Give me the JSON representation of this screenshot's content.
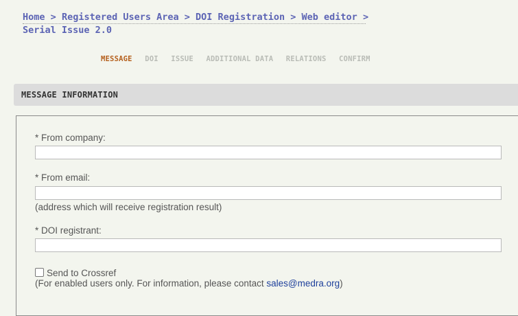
{
  "breadcrumb": {
    "home": "Home",
    "registered_users_area": "Registered Users Area",
    "doi_registration": "DOI Registration",
    "web_editor": "Web editor",
    "separator": ">",
    "current": "Serial Issue 2.0"
  },
  "steps": [
    {
      "label": "MESSAGE",
      "active": true
    },
    {
      "label": "DOI",
      "active": false
    },
    {
      "label": "ISSUE",
      "active": false
    },
    {
      "label": "ADDITIONAL DATA",
      "active": false
    },
    {
      "label": "RELATIONS",
      "active": false
    },
    {
      "label": "CONFIRM",
      "active": false
    }
  ],
  "section": {
    "title": "MESSAGE INFORMATION"
  },
  "form": {
    "from_company": {
      "label": "* From company:",
      "value": ""
    },
    "from_email": {
      "label": "* From email:",
      "value": "",
      "note": "(address which will receive registration result)"
    },
    "doi_registrant": {
      "label": "* DOI registrant:",
      "value": ""
    },
    "crossref": {
      "label": "Send to Crossref",
      "checked": false,
      "note_prefix": "(For enabled users only. For information, please contact ",
      "email": "sales@medra.org",
      "note_suffix": ")"
    }
  },
  "colors": {
    "background": "#f3f5ee",
    "link": "#5c64b4",
    "active_step": "#b5601d",
    "inactive_step": "#b9bcb6",
    "contact_link": "#1d3f9b"
  }
}
